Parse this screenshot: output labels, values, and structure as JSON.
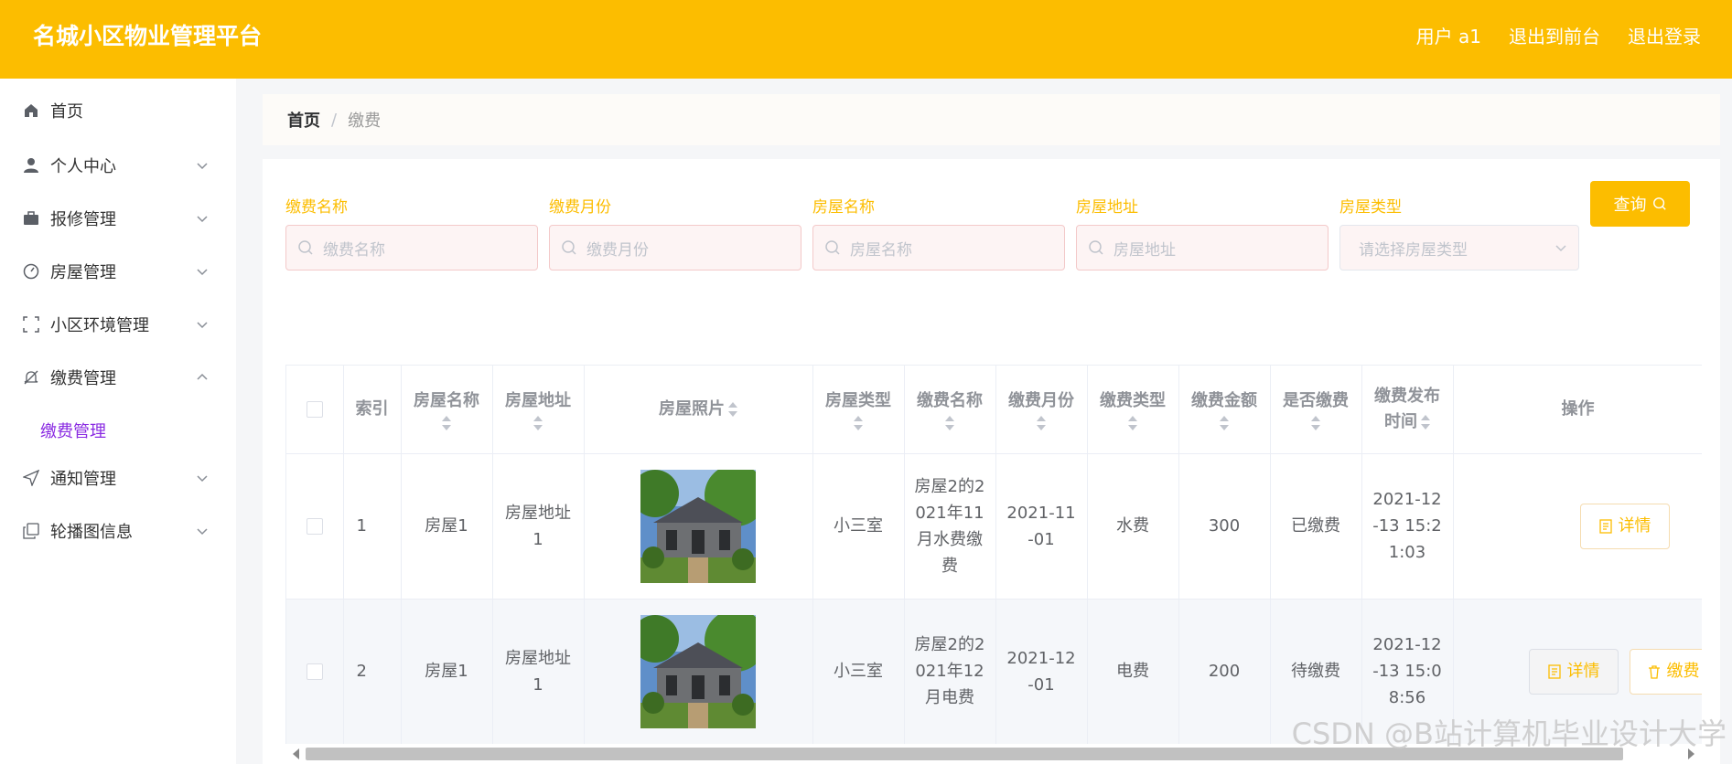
{
  "header": {
    "brand": "名城小区物业管理平台",
    "user": "用户 a1",
    "to_front": "退出到前台",
    "logout": "退出登录"
  },
  "sidebar": {
    "items": [
      {
        "label": "首页",
        "icon": "home-icon"
      },
      {
        "label": "个人中心",
        "icon": "user-icon"
      },
      {
        "label": "报修管理",
        "icon": "briefcase-icon"
      },
      {
        "label": "房屋管理",
        "icon": "gauge-icon"
      },
      {
        "label": "小区环境管理",
        "icon": "fullscreen-icon"
      },
      {
        "label": "缴费管理",
        "icon": "bell-off-icon"
      },
      {
        "label": "通知管理",
        "icon": "send-icon"
      },
      {
        "label": "轮播图信息",
        "icon": "copy-icon"
      }
    ],
    "submenu": {
      "label": "缴费管理"
    }
  },
  "breadcrumb": {
    "home": "首页",
    "sep": "/",
    "current": "缴费"
  },
  "filters": [
    {
      "label": "缴费名称",
      "placeholder": "缴费名称"
    },
    {
      "label": "缴费月份",
      "placeholder": "缴费月份"
    },
    {
      "label": "房屋名称",
      "placeholder": "房屋名称"
    },
    {
      "label": "房屋地址",
      "placeholder": "房屋地址"
    },
    {
      "label": "房屋类型",
      "placeholder": "请选择房屋类型"
    }
  ],
  "query_button": "查询",
  "table": {
    "headers": {
      "index": "索引",
      "house_name": "房屋名称",
      "house_address": "房屋地址",
      "house_photo": "房屋照片",
      "house_type": "房屋类型",
      "fee_name": "缴费名称",
      "fee_month": "缴费月份",
      "fee_type": "缴费类型",
      "fee_amount": "缴费金额",
      "is_paid": "是否缴费",
      "publish_time": "缴费发布时间",
      "actions": "操作"
    },
    "rows": [
      {
        "index": "1",
        "house_name": "房屋1",
        "house_address": "房屋地址1",
        "house_type": "小三室",
        "fee_name": "房屋2的2021年11月水费缴费",
        "fee_month": "2021-11-01",
        "fee_type": "水费",
        "fee_amount": "300",
        "is_paid": "已缴费",
        "publish_time": "2021-12-13 15:21:03"
      },
      {
        "index": "2",
        "house_name": "房屋1",
        "house_address": "房屋地址1",
        "house_type": "小三室",
        "fee_name": "房屋2的2021年12月电费",
        "fee_month": "2021-12-01",
        "fee_type": "电费",
        "fee_amount": "200",
        "is_paid": "待缴费",
        "publish_time": "2021-12-13 15:08:56"
      }
    ],
    "detail_label": "详情",
    "pay_label": "缴费"
  },
  "watermark": "CSDN @B站计算机毕业设计大学",
  "colors": {
    "accent": "#fcbd00",
    "submenu_active": "#8a2be2"
  }
}
